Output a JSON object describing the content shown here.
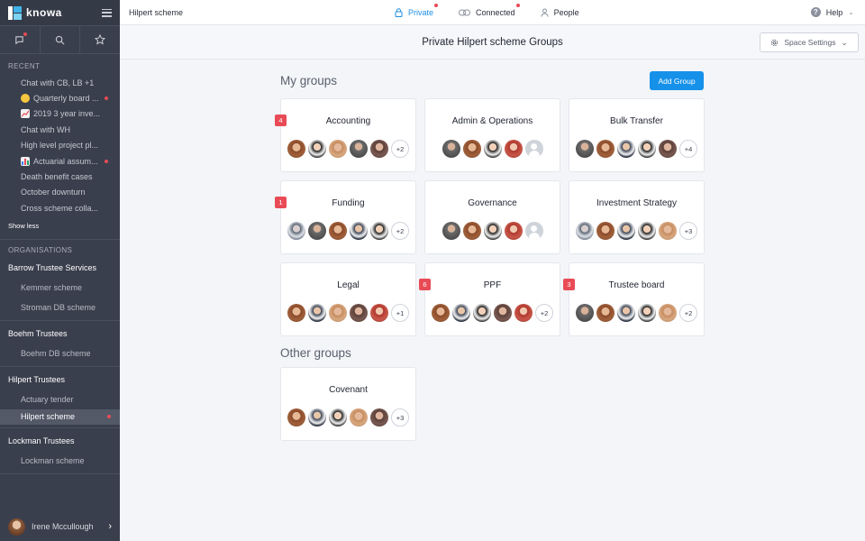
{
  "app": {
    "brand": "knowa",
    "accent": "#1591ea",
    "badge_color": "#e84b56"
  },
  "sidebar": {
    "recent_label": "RECENT",
    "recent": [
      {
        "label": "Chat with CB, LB +1",
        "emoji": "",
        "unread": false
      },
      {
        "label": "Quarterly board ...",
        "emoji": "smiley",
        "unread": true
      },
      {
        "label": "2019 3 year inve...",
        "emoji": "chart-up",
        "unread": false
      },
      {
        "label": "Chat with WH",
        "emoji": "",
        "unread": false
      },
      {
        "label": "High level project pl...",
        "emoji": "",
        "unread": false
      },
      {
        "label": "Actuarial assum...",
        "emoji": "bar-chart",
        "unread": true
      },
      {
        "label": "Death benefit cases",
        "emoji": "",
        "unread": false
      },
      {
        "label": "October downturn",
        "emoji": "",
        "unread": false
      },
      {
        "label": "Cross scheme colla...",
        "emoji": "",
        "unread": false
      }
    ],
    "show_less": "Show less",
    "orgs_label": "ORGANISATIONS",
    "orgs": [
      {
        "name": "Barrow Trustee Services",
        "schemes": [
          "Kemmer scheme",
          "Stroman DB scheme"
        ]
      },
      {
        "name": "Boehm Trustees",
        "schemes": [
          "Boehm DB scheme"
        ]
      },
      {
        "name": "Hilpert Trustees",
        "schemes": [
          "Actuary tender",
          "Hilpert scheme"
        ]
      },
      {
        "name": "Lockman Trustees",
        "schemes": [
          "Lockman scheme"
        ]
      }
    ],
    "user": "Irene Mccullough"
  },
  "topbar": {
    "title": "Hilpert scheme",
    "nav": [
      "Private",
      "Connected",
      "People"
    ],
    "help": "Help"
  },
  "page": {
    "title": "Private Hilpert scheme Groups",
    "space_settings": "Space Settings",
    "my_groups": "My groups",
    "add_group": "Add Group",
    "other_groups": "Other groups"
  },
  "groups": [
    {
      "name": "Accounting",
      "badge": "4",
      "more": "+2"
    },
    {
      "name": "Admin & Operations",
      "badge": "",
      "more": ""
    },
    {
      "name": "Bulk Transfer",
      "badge": "",
      "more": "+4"
    },
    {
      "name": "Funding",
      "badge": "1",
      "more": "+2"
    },
    {
      "name": "Governance",
      "badge": "",
      "more": ""
    },
    {
      "name": "Investment Strategy",
      "badge": "",
      "more": "+3"
    },
    {
      "name": "Legal",
      "badge": "",
      "more": "+1"
    },
    {
      "name": "PPF",
      "badge": "6",
      "more": "+2"
    },
    {
      "name": "Trustee board",
      "badge": "3",
      "more": "+2"
    }
  ],
  "other": [
    {
      "name": "Covenant",
      "badge": "",
      "more": "+3"
    }
  ]
}
